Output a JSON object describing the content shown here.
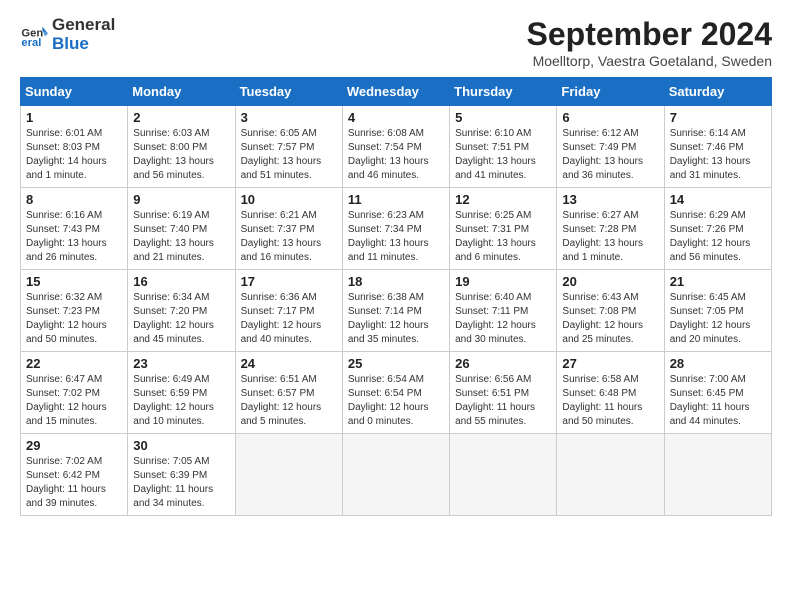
{
  "header": {
    "logo_line1": "General",
    "logo_line2": "Blue",
    "month_title": "September 2024",
    "location": "Moelltorp, Vaestra Goetaland, Sweden"
  },
  "weekdays": [
    "Sunday",
    "Monday",
    "Tuesday",
    "Wednesday",
    "Thursday",
    "Friday",
    "Saturday"
  ],
  "weeks": [
    [
      {
        "day": "1",
        "sunrise": "6:01 AM",
        "sunset": "8:03 PM",
        "daylight": "14 hours and 1 minute."
      },
      {
        "day": "2",
        "sunrise": "6:03 AM",
        "sunset": "8:00 PM",
        "daylight": "13 hours and 56 minutes."
      },
      {
        "day": "3",
        "sunrise": "6:05 AM",
        "sunset": "7:57 PM",
        "daylight": "13 hours and 51 minutes."
      },
      {
        "day": "4",
        "sunrise": "6:08 AM",
        "sunset": "7:54 PM",
        "daylight": "13 hours and 46 minutes."
      },
      {
        "day": "5",
        "sunrise": "6:10 AM",
        "sunset": "7:51 PM",
        "daylight": "13 hours and 41 minutes."
      },
      {
        "day": "6",
        "sunrise": "6:12 AM",
        "sunset": "7:49 PM",
        "daylight": "13 hours and 36 minutes."
      },
      {
        "day": "7",
        "sunrise": "6:14 AM",
        "sunset": "7:46 PM",
        "daylight": "13 hours and 31 minutes."
      }
    ],
    [
      {
        "day": "8",
        "sunrise": "6:16 AM",
        "sunset": "7:43 PM",
        "daylight": "13 hours and 26 minutes."
      },
      {
        "day": "9",
        "sunrise": "6:19 AM",
        "sunset": "7:40 PM",
        "daylight": "13 hours and 21 minutes."
      },
      {
        "day": "10",
        "sunrise": "6:21 AM",
        "sunset": "7:37 PM",
        "daylight": "13 hours and 16 minutes."
      },
      {
        "day": "11",
        "sunrise": "6:23 AM",
        "sunset": "7:34 PM",
        "daylight": "13 hours and 11 minutes."
      },
      {
        "day": "12",
        "sunrise": "6:25 AM",
        "sunset": "7:31 PM",
        "daylight": "13 hours and 6 minutes."
      },
      {
        "day": "13",
        "sunrise": "6:27 AM",
        "sunset": "7:28 PM",
        "daylight": "13 hours and 1 minute."
      },
      {
        "day": "14",
        "sunrise": "6:29 AM",
        "sunset": "7:26 PM",
        "daylight": "12 hours and 56 minutes."
      }
    ],
    [
      {
        "day": "15",
        "sunrise": "6:32 AM",
        "sunset": "7:23 PM",
        "daylight": "12 hours and 50 minutes."
      },
      {
        "day": "16",
        "sunrise": "6:34 AM",
        "sunset": "7:20 PM",
        "daylight": "12 hours and 45 minutes."
      },
      {
        "day": "17",
        "sunrise": "6:36 AM",
        "sunset": "7:17 PM",
        "daylight": "12 hours and 40 minutes."
      },
      {
        "day": "18",
        "sunrise": "6:38 AM",
        "sunset": "7:14 PM",
        "daylight": "12 hours and 35 minutes."
      },
      {
        "day": "19",
        "sunrise": "6:40 AM",
        "sunset": "7:11 PM",
        "daylight": "12 hours and 30 minutes."
      },
      {
        "day": "20",
        "sunrise": "6:43 AM",
        "sunset": "7:08 PM",
        "daylight": "12 hours and 25 minutes."
      },
      {
        "day": "21",
        "sunrise": "6:45 AM",
        "sunset": "7:05 PM",
        "daylight": "12 hours and 20 minutes."
      }
    ],
    [
      {
        "day": "22",
        "sunrise": "6:47 AM",
        "sunset": "7:02 PM",
        "daylight": "12 hours and 15 minutes."
      },
      {
        "day": "23",
        "sunrise": "6:49 AM",
        "sunset": "6:59 PM",
        "daylight": "12 hours and 10 minutes."
      },
      {
        "day": "24",
        "sunrise": "6:51 AM",
        "sunset": "6:57 PM",
        "daylight": "12 hours and 5 minutes."
      },
      {
        "day": "25",
        "sunrise": "6:54 AM",
        "sunset": "6:54 PM",
        "daylight": "12 hours and 0 minutes."
      },
      {
        "day": "26",
        "sunrise": "6:56 AM",
        "sunset": "6:51 PM",
        "daylight": "11 hours and 55 minutes."
      },
      {
        "day": "27",
        "sunrise": "6:58 AM",
        "sunset": "6:48 PM",
        "daylight": "11 hours and 50 minutes."
      },
      {
        "day": "28",
        "sunrise": "7:00 AM",
        "sunset": "6:45 PM",
        "daylight": "11 hours and 44 minutes."
      }
    ],
    [
      {
        "day": "29",
        "sunrise": "7:02 AM",
        "sunset": "6:42 PM",
        "daylight": "11 hours and 39 minutes."
      },
      {
        "day": "30",
        "sunrise": "7:05 AM",
        "sunset": "6:39 PM",
        "daylight": "11 hours and 34 minutes."
      },
      null,
      null,
      null,
      null,
      null
    ]
  ]
}
